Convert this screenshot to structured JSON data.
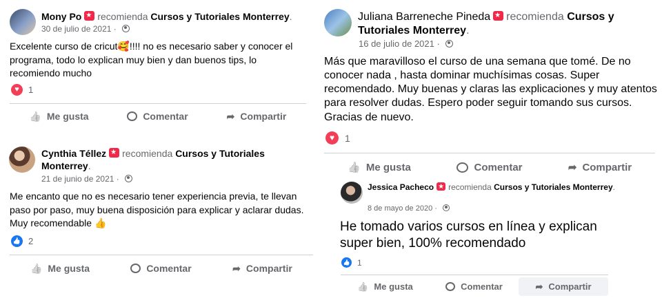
{
  "reviews": [
    {
      "user": "Mony Po",
      "verb": "recomienda",
      "page": "Cursos y Tutoriales Monterrey",
      "date": "30 de julio de 2021",
      "text": "Excelente curso de cricut🥰!!!! no es necesario saber y conocer el programa, todo lo explican muy bien y dan buenos tips, lo recomiendo mucho",
      "reaction_icon": "heart-icon",
      "reaction_count": "1"
    },
    {
      "user": "Cynthia Téllez",
      "verb": "recomienda",
      "page": "Cursos y Tutoriales Monterrey",
      "date": "21 de junio de 2021",
      "text": "Me encanto que no es necesario tener experiencia previa, te llevan paso por paso, muy buena disposición para explicar y aclarar dudas. Muy recomendable 👍",
      "reaction_icon": "like-icon",
      "reaction_count": "2"
    },
    {
      "user": "Juliana Barreneche Pineda",
      "verb": "recomienda",
      "page": "Cursos y Tutoriales Monterrey",
      "date": "16 de julio de 2021",
      "text": "Más que maravilloso el curso de una semana que tomé. De no conocer nada , hasta dominar muchísimas cosas. Super recomendado. Muy buenas y claras las explicaciones y muy atentos para resolver dudas. Espero poder seguir tomando sus cursos. Gracias de nuevo.",
      "reaction_icon": "heart-icon",
      "reaction_count": "1"
    },
    {
      "user": "Jessica Pacheco",
      "verb": "recomienda",
      "page": "Cursos y Tutoriales Monterrey",
      "date": "8 de mayo de 2020",
      "text": "He tomado varios cursos en línea y explican super bien, 100% recomendado",
      "reaction_icon": "like-icon",
      "reaction_count": "1"
    }
  ],
  "actions": {
    "like": "Me gusta",
    "comment": "Comentar",
    "share": "Compartir"
  },
  "colors": {
    "like_blue": "#1877f2",
    "love_red": "#f33e58",
    "badge_red": "#f02849",
    "muted": "#65676b"
  }
}
